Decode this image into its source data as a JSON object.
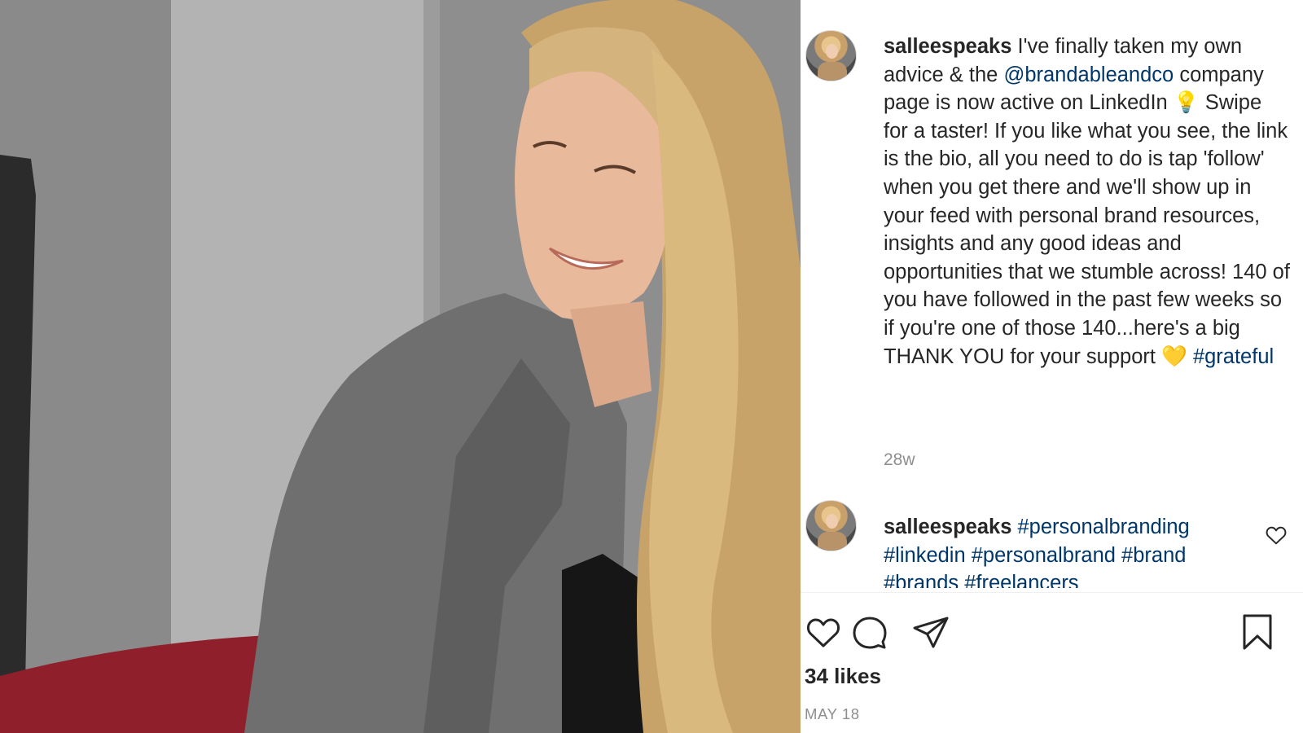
{
  "post": {
    "author": "salleespeaks",
    "caption": {
      "part1": "I've finally taken my own advice & the",
      "mention": "@brandableandco",
      "part2": "company page is now active on LinkedIn",
      "bulb_emoji": "💡",
      "part3": "Swipe for a taster! If you like what you see, the link is the bio, all you need to do is tap 'follow' when you get there and we'll show up in your feed with personal brand resources, insights and any good ideas and opportunities that we stumble across! 140 of you have followed in the past few weeks so if you're one of those 140...here's a big THANK YOU for your support",
      "heart_emoji": "💛",
      "hashtag": "#grateful"
    },
    "time_ago": "28w",
    "comments": [
      {
        "author": "salleespeaks",
        "hashtags": "#personalbranding #linkedin #personalbrand #brand #brands #freelancers"
      }
    ],
    "likes": "34 likes",
    "date": "MAY 18"
  },
  "icons": {
    "like": "heart-outline-icon",
    "comment": "speech-bubble-icon",
    "share": "paper-plane-icon",
    "save": "bookmark-icon",
    "comment_like": "small-heart-icon"
  },
  "colors": {
    "text": "#262626",
    "link": "#00376b",
    "muted": "#8e8e8e",
    "divider": "#efefef"
  }
}
